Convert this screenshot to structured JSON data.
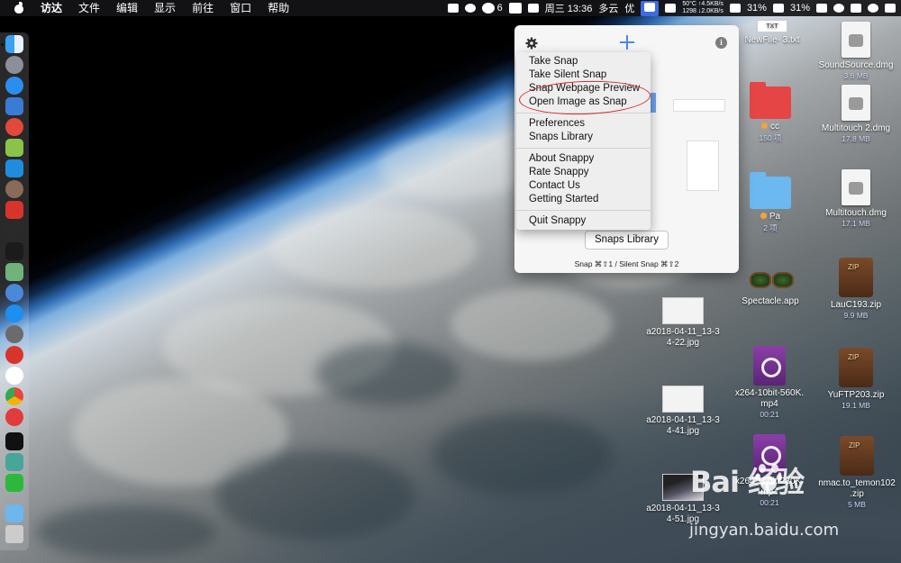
{
  "menubar": {
    "items": [
      "访达",
      "文件",
      "编辑",
      "显示",
      "前往",
      "窗口",
      "帮助"
    ],
    "status": {
      "wechat_count": "6",
      "monitor": {
        "temp_label": "50°C",
        "up": "↑4.5KB/s",
        "fan": "1298",
        "down": "↓2.0KB/s"
      },
      "clock": "周三 13:36",
      "weather": "多云",
      "input_method": "优",
      "battery_percent_1": "31%",
      "battery_percent_2": "31%"
    }
  },
  "popover": {
    "snaps_library_button": "Snaps Library",
    "shortcut_hint": "Snap ⌘⇧1 / Silent Snap ⌘⇧2"
  },
  "menu": {
    "group1": [
      "Take Snap",
      "Take Silent Snap",
      "Snap Webpage Preview",
      "Open Image as Snap"
    ],
    "group2": [
      "Preferences",
      "Snaps Library"
    ],
    "group3": [
      "About Snappy",
      "Rate Snappy",
      "Contact Us",
      "Getting Started"
    ],
    "group4": [
      "Quit Snappy"
    ]
  },
  "desktop": {
    "files": [
      {
        "name": "NewFile- 3.txt",
        "badge": "TXT"
      },
      {
        "name": "SoundSource.dmg",
        "size": "3.6 MB"
      },
      {
        "name": "cc",
        "size": "150 项"
      },
      {
        "name": "Multitouch 2.dmg",
        "size": "17.8 MB"
      },
      {
        "name": "Pa",
        "size": "2 项"
      },
      {
        "name": "Multitouch.dmg",
        "size": "17.1 MB"
      },
      {
        "name": "Spectacle.app"
      },
      {
        "name": "LauC193.zip",
        "size": "9.9 MB"
      },
      {
        "name": "a2018-04-11_13-34-22.jpg",
        "line1": "a2018-04-11_13-3",
        "line2": "4-22.jpg"
      },
      {
        "name": "x264-10bit-560K.mp4",
        "line1": "x264-10bit-560K.",
        "line2": "mp4",
        "size": "00:21"
      },
      {
        "name": "YuFTP203.zip",
        "size": "19.1 MB"
      },
      {
        "name": "a2018-04-11_13-34-41.jpg",
        "line1": "a2018-04-11_13-3",
        "line2": "4-41.jpg"
      },
      {
        "name": "x264-10bit-280K.mp4",
        "line1": "x264-10bit-280K.",
        "line2": "mp4",
        "size": "00:21"
      },
      {
        "name": "nmac.to_temon102.zip",
        "line1": "nmac.to_temon102",
        "line2": ".zip",
        "size": "5 MB"
      },
      {
        "name": "a2018-04-11_13-34-51.jpg",
        "line1": "a2018-04-11_13-3",
        "line2": "4-51.jpg"
      }
    ]
  },
  "watermark": {
    "text": "Bai 经验",
    "url": "jingyan.baidu.com"
  },
  "colors": {
    "accent_blue": "#4a8ae6",
    "annotation_red": "#d12b2b",
    "menubar": "#141416"
  }
}
